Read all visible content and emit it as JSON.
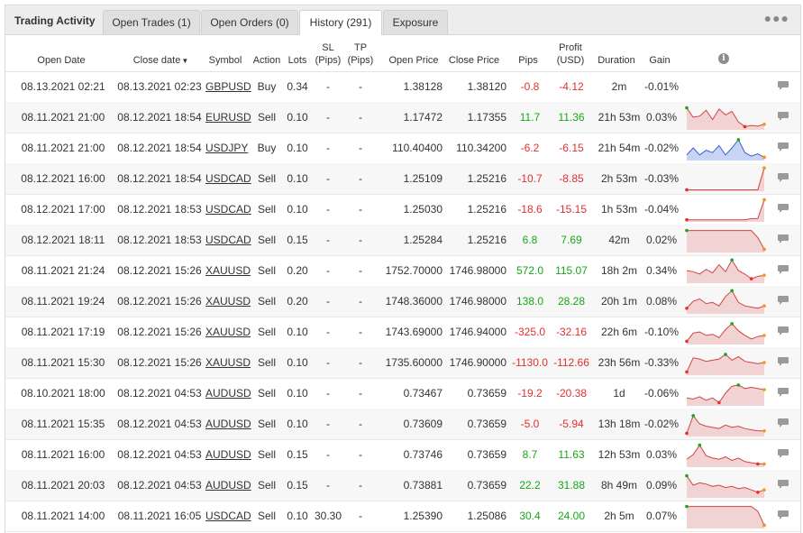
{
  "tabs": {
    "title": "Trading Activity",
    "items": [
      {
        "label": "Open Trades (1)"
      },
      {
        "label": "Open Orders (0)"
      },
      {
        "label": "History (291)"
      },
      {
        "label": "Exposure"
      }
    ],
    "active": "History (291)"
  },
  "headers": {
    "open_date": "Open Date",
    "close_date": "Close date",
    "symbol": "Symbol",
    "action": "Action",
    "lots": "Lots",
    "sl_top": "SL",
    "sl_bottom": "(Pips)",
    "tp_top": "TP",
    "tp_bottom": "(Pips)",
    "open_price": "Open Price",
    "close_price": "Close Price",
    "pips": "Pips",
    "profit_top": "Profit",
    "profit_bottom": "(USD)",
    "duration": "Duration",
    "gain": "Gain"
  },
  "colors": {
    "positive": "#1aa51a",
    "negative": "#e03030",
    "spark_red_fill": "#f2d3d3",
    "spark_blue_fill": "#c8d4f3"
  },
  "rows": [
    {
      "open_date": "08.13.2021 02:21",
      "close_date": "08.13.2021 02:23",
      "symbol": "GBPUSD",
      "action": "Buy",
      "lots": "0.34",
      "sl": "-",
      "tp": "-",
      "open_price": "1.38128",
      "close_price": "1.38120",
      "pips": "-0.8",
      "profit": "-4.12",
      "duration": "2m",
      "gain": "-0.01%",
      "spark": null
    },
    {
      "open_date": "08.11.2021 21:00",
      "close_date": "08.12.2021 18:54",
      "symbol": "EURUSD",
      "action": "Sell",
      "lots": "0.10",
      "sl": "-",
      "tp": "-",
      "open_price": "1.17472",
      "close_price": "1.17355",
      "pips": "11.7",
      "profit": "11.36",
      "duration": "21h 53m",
      "gain": "0.03%",
      "spark": {
        "color": "red",
        "values": [
          0.9,
          0.5,
          0.55,
          0.8,
          0.4,
          0.85,
          0.6,
          0.75,
          0.3,
          0.1,
          0.15,
          0.12,
          0.2
        ]
      }
    },
    {
      "open_date": "08.11.2021 21:00",
      "close_date": "08.12.2021 18:54",
      "symbol": "USDJPY",
      "action": "Buy",
      "lots": "0.10",
      "sl": "-",
      "tp": "-",
      "open_price": "110.40400",
      "close_price": "110.34200",
      "pips": "-6.2",
      "profit": "-6.15",
      "duration": "21h 54m",
      "gain": "-0.02%",
      "spark": {
        "color": "blue",
        "values": [
          0.2,
          0.5,
          0.2,
          0.4,
          0.3,
          0.6,
          0.2,
          0.5,
          0.85,
          0.3,
          0.15,
          0.25,
          0.1
        ]
      }
    },
    {
      "open_date": "08.12.2021 16:00",
      "close_date": "08.12.2021 18:54",
      "symbol": "USDCAD",
      "action": "Sell",
      "lots": "0.10",
      "sl": "-",
      "tp": "-",
      "open_price": "1.25109",
      "close_price": "1.25216",
      "pips": "-10.7",
      "profit": "-8.85",
      "duration": "2h 53m",
      "gain": "-0.03%",
      "spark": {
        "color": "red",
        "values": [
          0.02,
          0.02,
          0.02,
          0.02,
          0.02,
          0.02,
          0.02,
          0.02,
          0.02,
          0.02,
          0.02,
          0.02,
          0.95
        ]
      }
    },
    {
      "open_date": "08.12.2021 17:00",
      "close_date": "08.12.2021 18:53",
      "symbol": "USDCAD",
      "action": "Sell",
      "lots": "0.10",
      "sl": "-",
      "tp": "-",
      "open_price": "1.25030",
      "close_price": "1.25216",
      "pips": "-18.6",
      "profit": "-15.15",
      "duration": "1h 53m",
      "gain": "-0.04%",
      "spark": {
        "color": "red",
        "values": [
          0.05,
          0.05,
          0.05,
          0.05,
          0.05,
          0.05,
          0.05,
          0.05,
          0.05,
          0.05,
          0.1,
          0.1,
          0.9
        ]
      }
    },
    {
      "open_date": "08.12.2021 18:11",
      "close_date": "08.12.2021 18:53",
      "symbol": "USDCAD",
      "action": "Sell",
      "lots": "0.15",
      "sl": "-",
      "tp": "-",
      "open_price": "1.25284",
      "close_price": "1.25216",
      "pips": "6.8",
      "profit": "7.69",
      "duration": "42m",
      "gain": "0.02%",
      "spark": {
        "color": "red",
        "values": [
          0.9,
          0.9,
          0.9,
          0.9,
          0.9,
          0.9,
          0.9,
          0.9,
          0.9,
          0.9,
          0.9,
          0.6,
          0.1
        ]
      }
    },
    {
      "open_date": "08.11.2021 21:24",
      "close_date": "08.12.2021 15:26",
      "symbol": "XAUUSD",
      "action": "Sell",
      "lots": "0.20",
      "sl": "-",
      "tp": "-",
      "open_price": "1752.70000",
      "close_price": "1746.98000",
      "pips": "572.0",
      "profit": "115.07",
      "duration": "18h 2m",
      "gain": "0.34%",
      "spark": {
        "color": "red",
        "values": [
          0.5,
          0.45,
          0.35,
          0.55,
          0.4,
          0.75,
          0.45,
          0.95,
          0.5,
          0.35,
          0.15,
          0.25,
          0.3
        ]
      }
    },
    {
      "open_date": "08.11.2021 19:24",
      "close_date": "08.12.2021 15:26",
      "symbol": "XAUUSD",
      "action": "Sell",
      "lots": "0.20",
      "sl": "-",
      "tp": "-",
      "open_price": "1748.36000",
      "close_price": "1746.98000",
      "pips": "138.0",
      "profit": "28.28",
      "duration": "20h 1m",
      "gain": "0.08%",
      "spark": {
        "color": "red",
        "values": [
          0.2,
          0.5,
          0.6,
          0.4,
          0.45,
          0.3,
          0.7,
          0.95,
          0.45,
          0.3,
          0.25,
          0.2,
          0.3
        ]
      }
    },
    {
      "open_date": "08.11.2021 17:19",
      "close_date": "08.12.2021 15:26",
      "symbol": "XAUUSD",
      "action": "Sell",
      "lots": "0.10",
      "sl": "-",
      "tp": "-",
      "open_price": "1743.69000",
      "close_price": "1746.94000",
      "pips": "-325.0",
      "profit": "-32.16",
      "duration": "22h 6m",
      "gain": "-0.10%",
      "spark": {
        "color": "red",
        "values": [
          0.1,
          0.45,
          0.5,
          0.35,
          0.4,
          0.25,
          0.6,
          0.85,
          0.55,
          0.35,
          0.2,
          0.3,
          0.35
        ]
      }
    },
    {
      "open_date": "08.11.2021 15:30",
      "close_date": "08.12.2021 15:26",
      "symbol": "XAUUSD",
      "action": "Sell",
      "lots": "0.10",
      "sl": "-",
      "tp": "-",
      "open_price": "1735.60000",
      "close_price": "1746.90000",
      "pips": "-1130.0",
      "profit": "-112.66",
      "duration": "23h 56m",
      "gain": "-0.33%",
      "spark": {
        "color": "red",
        "values": [
          0.1,
          0.7,
          0.65,
          0.55,
          0.6,
          0.65,
          0.85,
          0.6,
          0.75,
          0.55,
          0.5,
          0.45,
          0.5
        ]
      }
    },
    {
      "open_date": "08.10.2021 18:00",
      "close_date": "08.12.2021 04:53",
      "symbol": "AUDUSD",
      "action": "Sell",
      "lots": "0.10",
      "sl": "-",
      "tp": "-",
      "open_price": "0.73467",
      "close_price": "0.73659",
      "pips": "-19.2",
      "profit": "-20.38",
      "duration": "1d",
      "gain": "-0.06%",
      "spark": {
        "color": "red",
        "values": [
          0.3,
          0.25,
          0.35,
          0.2,
          0.3,
          0.1,
          0.5,
          0.8,
          0.85,
          0.7,
          0.75,
          0.7,
          0.65
        ]
      }
    },
    {
      "open_date": "08.11.2021 15:35",
      "close_date": "08.12.2021 04:53",
      "symbol": "AUDUSD",
      "action": "Sell",
      "lots": "0.10",
      "sl": "-",
      "tp": "-",
      "open_price": "0.73609",
      "close_price": "0.73659",
      "pips": "-5.0",
      "profit": "-5.94",
      "duration": "13h 18m",
      "gain": "-0.02%",
      "spark": {
        "color": "red",
        "values": [
          0.1,
          0.85,
          0.5,
          0.4,
          0.35,
          0.3,
          0.45,
          0.35,
          0.4,
          0.3,
          0.25,
          0.2,
          0.2
        ]
      }
    },
    {
      "open_date": "08.11.2021 16:00",
      "close_date": "08.12.2021 04:53",
      "symbol": "AUDUSD",
      "action": "Sell",
      "lots": "0.15",
      "sl": "-",
      "tp": "-",
      "open_price": "0.73746",
      "close_price": "0.73659",
      "pips": "8.7",
      "profit": "11.63",
      "duration": "12h 53m",
      "gain": "0.03%",
      "spark": {
        "color": "red",
        "values": [
          0.3,
          0.5,
          0.9,
          0.45,
          0.35,
          0.3,
          0.4,
          0.25,
          0.35,
          0.2,
          0.15,
          0.1,
          0.1
        ]
      }
    },
    {
      "open_date": "08.11.2021 20:03",
      "close_date": "08.12.2021 04:53",
      "symbol": "AUDUSD",
      "action": "Sell",
      "lots": "0.15",
      "sl": "-",
      "tp": "-",
      "open_price": "0.73881",
      "close_price": "0.73659",
      "pips": "22.2",
      "profit": "31.88",
      "duration": "8h 49m",
      "gain": "0.09%",
      "spark": {
        "color": "red",
        "values": [
          0.9,
          0.5,
          0.6,
          0.55,
          0.45,
          0.5,
          0.4,
          0.45,
          0.35,
          0.4,
          0.3,
          0.2,
          0.3
        ]
      }
    },
    {
      "open_date": "08.11.2021 14:00",
      "close_date": "08.11.2021 16:05",
      "symbol": "USDCAD",
      "action": "Sell",
      "lots": "0.10",
      "sl": "30.30",
      "tp": "-",
      "open_price": "1.25390",
      "close_price": "1.25086",
      "pips": "30.4",
      "profit": "24.00",
      "duration": "2h 5m",
      "gain": "0.07%",
      "spark": {
        "color": "red",
        "values": [
          0.9,
          0.9,
          0.9,
          0.9,
          0.9,
          0.9,
          0.9,
          0.9,
          0.9,
          0.9,
          0.9,
          0.7,
          0.1
        ]
      }
    }
  ]
}
